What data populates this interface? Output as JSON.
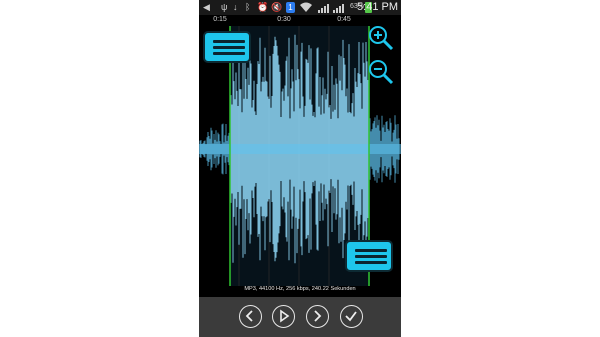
{
  "status_bar": {
    "notification_count": "1",
    "battery_percent": "63%",
    "clock": "5:41 PM"
  },
  "timeline": {
    "labels": [
      "0:15",
      "0:30",
      "0:45"
    ]
  },
  "file_info": "MP3, 44100 Hz, 256 kbps, 240.22 Sekunden",
  "colors": {
    "wave": "#5fc3f0",
    "selection_wave": "#8fd8f8",
    "marker": "#31c431",
    "handle": "#1ec6ec",
    "toolbar": "#3b3b3b"
  },
  "controls": {
    "icons": [
      "chevron-left-icon",
      "play-icon",
      "chevron-right-icon",
      "check-icon"
    ],
    "zoom": [
      "zoom-in-icon",
      "zoom-out-icon"
    ]
  }
}
